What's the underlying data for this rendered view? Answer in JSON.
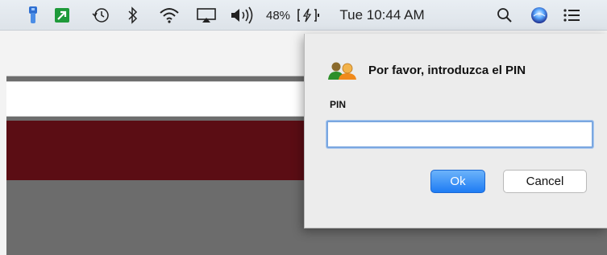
{
  "menubar": {
    "battery_percent": "48%",
    "clock": "Tue 10:44 AM",
    "icons": [
      "usb-key-icon",
      "green-arrow-icon",
      "time-machine-icon",
      "bluetooth-icon",
      "wifi-icon",
      "airplay-icon",
      "volume-icon",
      "battery-charging-icon",
      "spotlight-search-icon",
      "siri-icon",
      "notification-center-icon"
    ]
  },
  "dialog": {
    "title": "Por favor, introduzca el PIN",
    "pin_label": "PIN",
    "pin_value": "",
    "ok_label": "Ok",
    "cancel_label": "Cancel"
  },
  "colors": {
    "banner": "#5b0d14",
    "ok_button": "#1e7cf4",
    "input_focus": "#7aa7e0"
  }
}
